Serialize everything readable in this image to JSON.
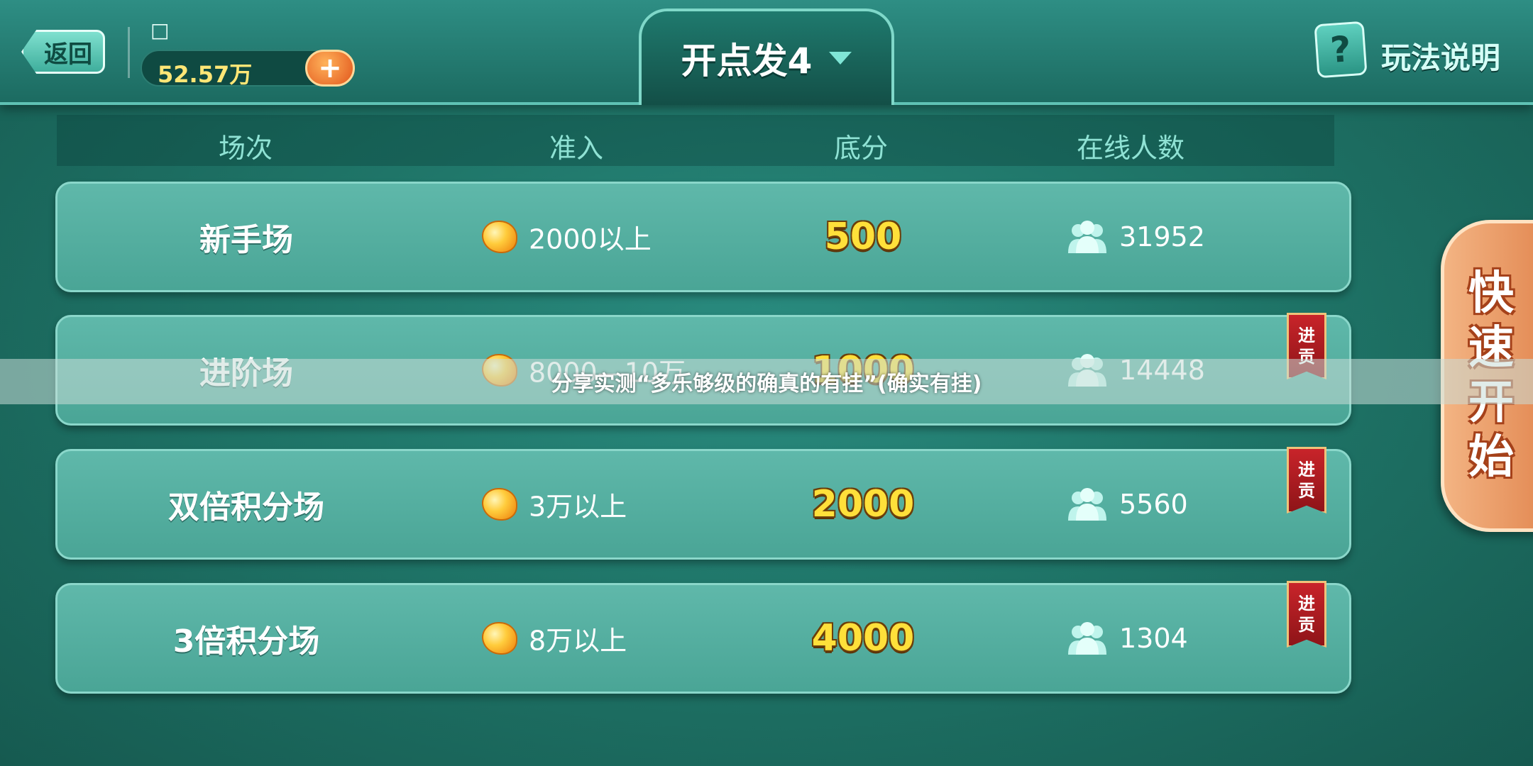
{
  "topbar": {
    "back_label": "返回",
    "player_name": "□",
    "coins": "52.57万",
    "add_symbol": "+",
    "title": "开点发4",
    "help_label": "玩法说明",
    "help_symbol": "?"
  },
  "columns": [
    "场次",
    "准入",
    "底分",
    "在线人数"
  ],
  "rooms": [
    {
      "name": "新手场",
      "entry": "2000以上",
      "score": "500",
      "online": "31952",
      "tribute": false
    },
    {
      "name": "进阶场",
      "entry": "8000—10万",
      "score": "1000",
      "online": "14448",
      "tribute": true
    },
    {
      "name": "双倍积分场",
      "entry": "3万以上",
      "score": "2000",
      "online": "5560",
      "tribute": true
    },
    {
      "name": "3倍积分场",
      "entry": "8万以上",
      "score": "4000",
      "online": "1304",
      "tribute": true
    }
  ],
  "tribute_label_top": "进",
  "tribute_label_bottom": "贡",
  "quick_start": [
    "快",
    "速",
    "开",
    "始"
  ],
  "overlay_text": "分享实测“多乐够级的确真的有挂”(确实有挂)",
  "colors": {
    "background": "#1f7568",
    "row": "#55ad9f",
    "score": "#ffe03a",
    "tribute": "#c8242a",
    "quick_start": "#e8955e"
  }
}
